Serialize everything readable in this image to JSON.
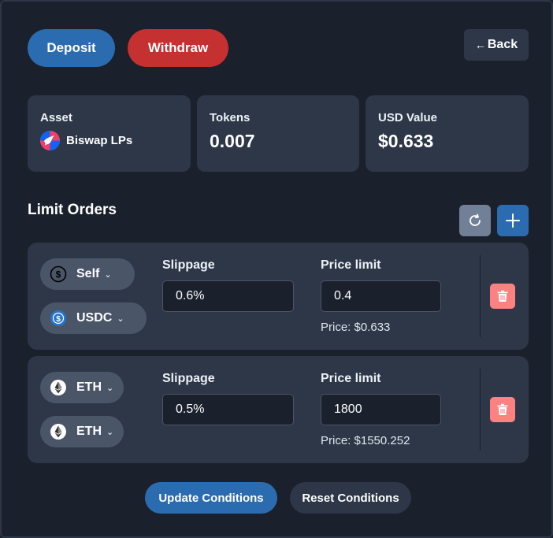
{
  "actions": {
    "deposit_label": "Deposit",
    "withdraw_label": "Withdraw",
    "back_label": "Back"
  },
  "summary": {
    "asset_label": "Asset",
    "asset_name": "Biswap LPs",
    "tokens_label": "Tokens",
    "tokens_value": "0.007",
    "usd_label": "USD Value",
    "usd_value": "$0.633"
  },
  "limit_orders": {
    "title": "Limit Orders",
    "orders": [
      {
        "selector_top": {
          "label": "Self",
          "icon": "dollar-circle-icon"
        },
        "selector_bottom": {
          "label": "USDC",
          "icon": "usdc-icon"
        },
        "slippage_label": "Slippage",
        "slippage_value": "0.6%",
        "price_limit_label": "Price limit",
        "price_limit_value": "0.4",
        "price_note": "Price: $0.633"
      },
      {
        "selector_top": {
          "label": "ETH",
          "icon": "eth-icon"
        },
        "selector_bottom": {
          "label": "ETH",
          "icon": "eth-icon"
        },
        "slippage_label": "Slippage",
        "slippage_value": "0.5%",
        "price_limit_label": "Price limit",
        "price_limit_value": "1800",
        "price_note": "Price: $1550.252"
      }
    ]
  },
  "footer": {
    "update_label": "Update Conditions",
    "reset_label": "Reset Conditions"
  },
  "colors": {
    "background": "#1a202c",
    "card": "#2d3748",
    "primary": "#2b6cb0",
    "danger": "#c53030",
    "trash": "#fc8181"
  }
}
